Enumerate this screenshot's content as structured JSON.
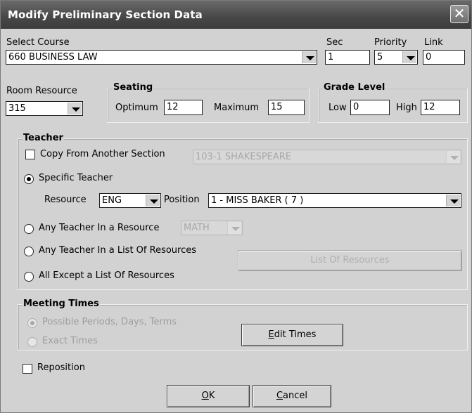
{
  "window": {
    "title": "Modify Preliminary Section Data",
    "close_glyph": "✕"
  },
  "course": {
    "label": "Select Course",
    "value": "660 BUSINESS LAW"
  },
  "sec": {
    "label": "Sec",
    "value": "1"
  },
  "priority": {
    "label": "Priority",
    "value": "5"
  },
  "link": {
    "label": "Link",
    "value": "0"
  },
  "room": {
    "label": "Room Resource",
    "value": "315"
  },
  "seating": {
    "title": "Seating",
    "optimum_label": "Optimum",
    "optimum_value": "12",
    "maximum_label": "Maximum",
    "maximum_value": "15"
  },
  "grade": {
    "title": "Grade Level",
    "low_label": "Low",
    "low_value": "0",
    "high_label": "High",
    "high_value": "12"
  },
  "teacher": {
    "title": "Teacher",
    "copy_label": "Copy From Another Section",
    "copy_value": "103-1 SHAKESPEARE",
    "specific_label": "Specific Teacher",
    "resource_label": "Resource",
    "resource_value": "ENG",
    "position_label": "Position",
    "position_value": "1 - MISS BAKER ( 7 )",
    "any_resource_label": "Any Teacher In a Resource",
    "any_resource_value": "MATH",
    "any_list_label": "Any Teacher In a List Of Resources",
    "all_except_label": "All Except a List Of Resources",
    "list_button": "List Of Resources"
  },
  "meeting": {
    "title": "Meeting Times",
    "possible_label": "Possible Periods, Days, Terms",
    "exact_label": "Exact Times",
    "edit_button": "Edit Times"
  },
  "reposition_label": "Reposition",
  "ok_button": "OK",
  "cancel_button": "Cancel"
}
